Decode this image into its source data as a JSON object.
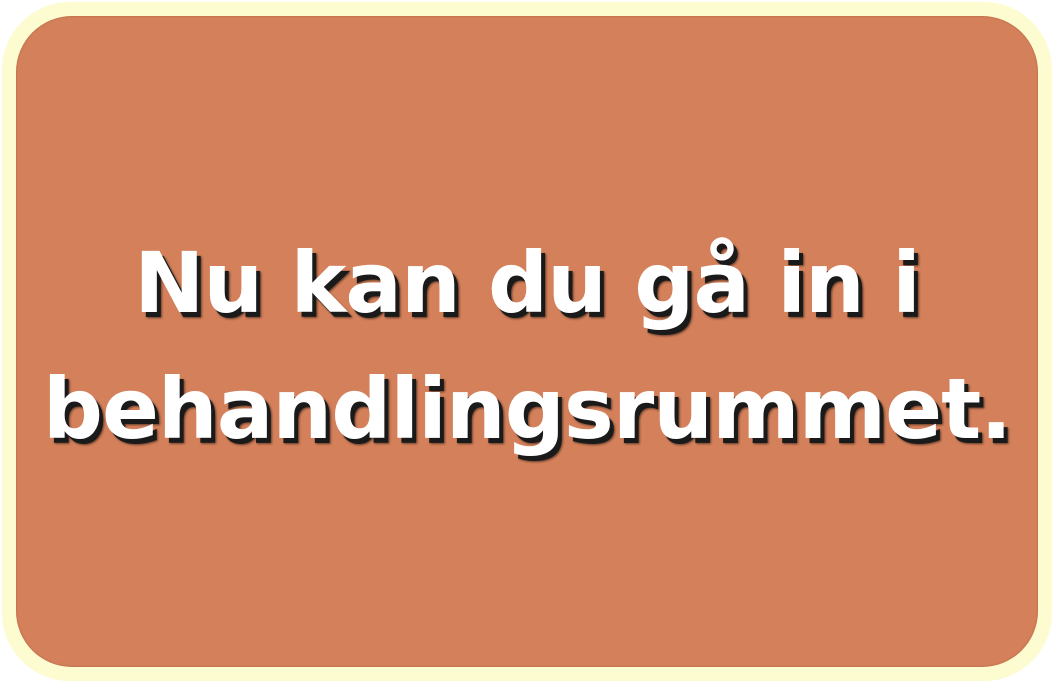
{
  "sign": {
    "lines": [
      "Nu kan du gå in i",
      "behandlingsrummet."
    ]
  },
  "colors": {
    "frame": "#fdfbd0",
    "card": "#d4805a",
    "text": "#ffffff",
    "shadow": "#1a1a1a"
  }
}
